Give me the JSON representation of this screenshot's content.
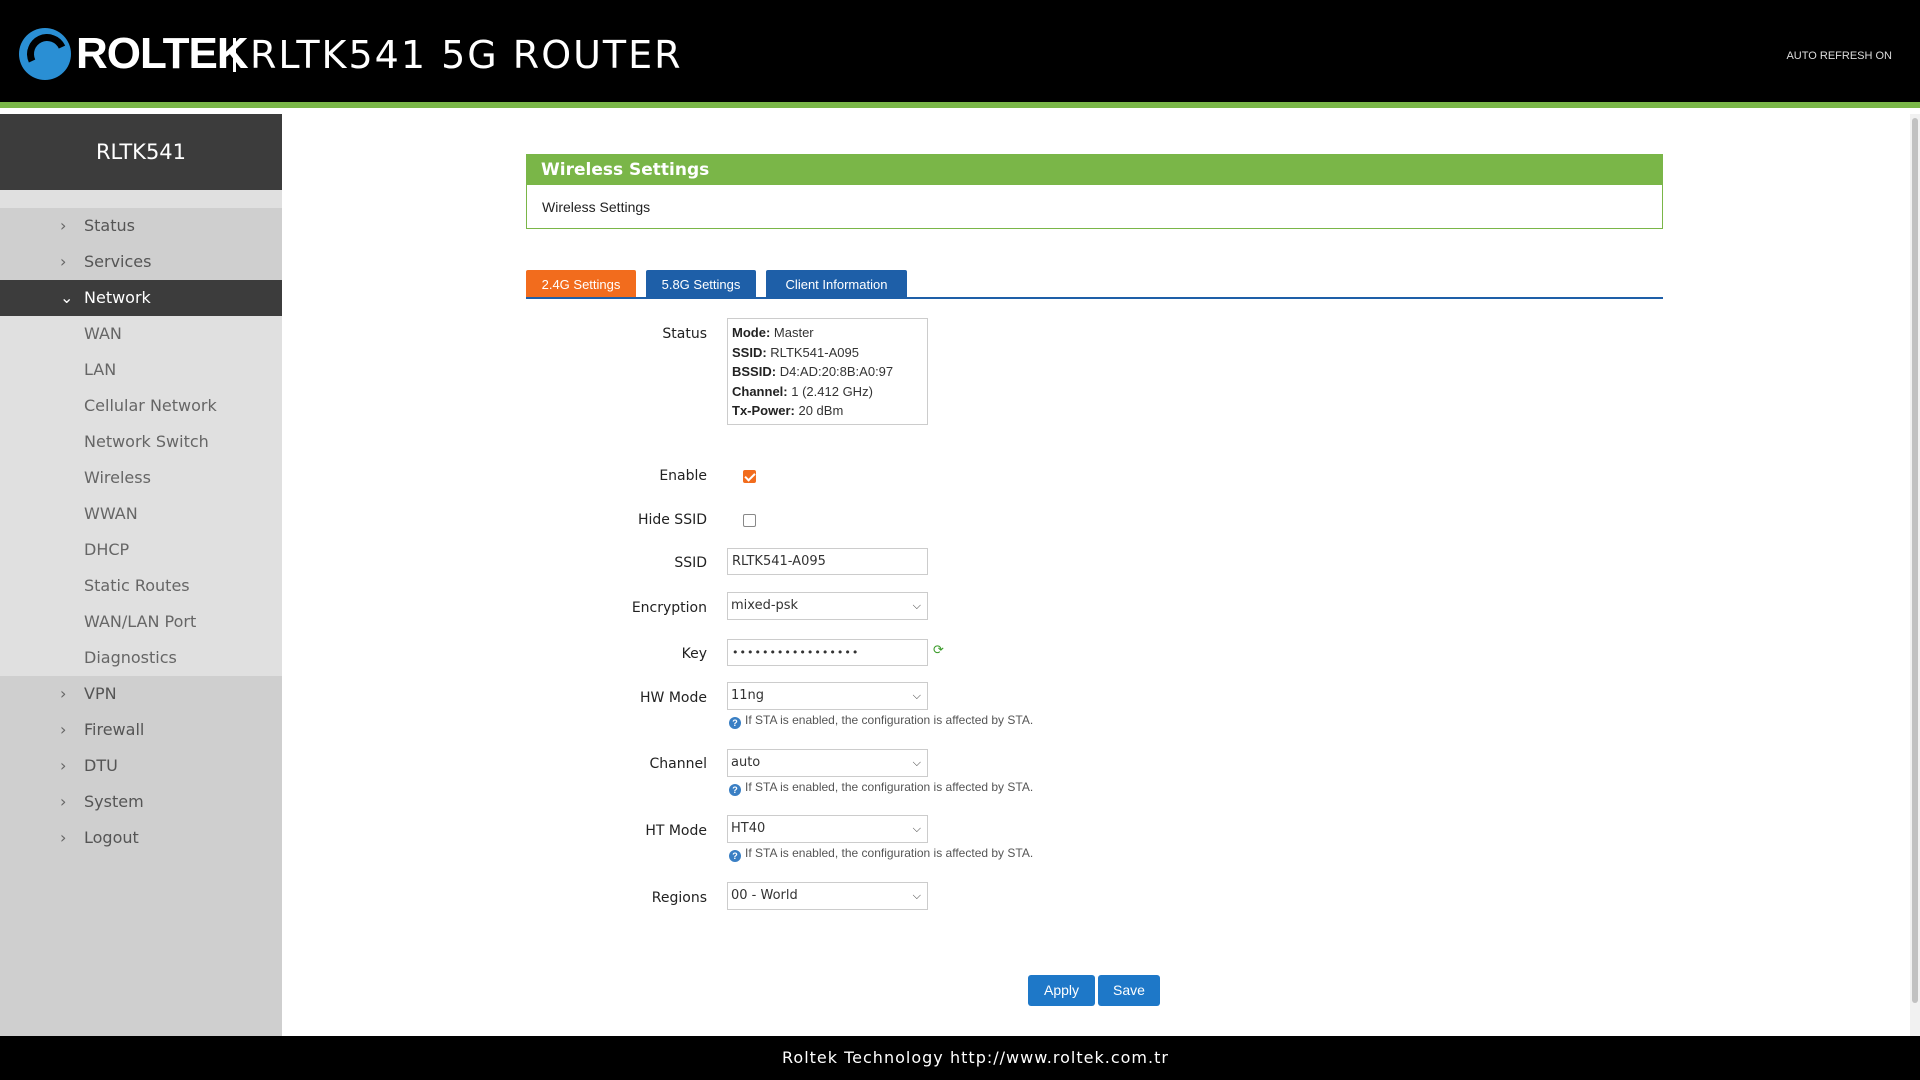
{
  "header": {
    "brand": "ROLTEK",
    "product": "RLTK541 5G ROUTER",
    "auto_refresh": "AUTO REFRESH ON"
  },
  "sidebar": {
    "title": "RLTK541",
    "items": [
      {
        "label": "Status"
      },
      {
        "label": "Services"
      },
      {
        "label": "Network"
      },
      {
        "label": "VPN"
      },
      {
        "label": "Firewall"
      },
      {
        "label": "DTU"
      },
      {
        "label": "System"
      },
      {
        "label": "Logout"
      }
    ],
    "network_sub": [
      {
        "label": "WAN"
      },
      {
        "label": "LAN"
      },
      {
        "label": "Cellular Network"
      },
      {
        "label": "Network Switch"
      },
      {
        "label": "Wireless"
      },
      {
        "label": "WWAN"
      },
      {
        "label": "DHCP"
      },
      {
        "label": "Static Routes"
      },
      {
        "label": "WAN/LAN Port"
      },
      {
        "label": "Diagnostics"
      }
    ]
  },
  "panel": {
    "title": "Wireless Settings",
    "body": "Wireless Settings"
  },
  "tabs": [
    {
      "label": "2.4G Settings"
    },
    {
      "label": "5.8G Settings"
    },
    {
      "label": "Client Information"
    }
  ],
  "form": {
    "status_label": "Status",
    "status": {
      "mode_key": "Mode:",
      "mode": "Master",
      "ssid_key": "SSID:",
      "ssid": "RLTK541-A095",
      "bssid_key": "BSSID:",
      "bssid": "D4:AD:20:8B:A0:97",
      "channel_key": "Channel:",
      "channel": "1 (2.412 GHz)",
      "txpower_key": "Tx-Power:",
      "txpower": "20 dBm"
    },
    "enable_label": "Enable",
    "enable_checked": true,
    "hide_ssid_label": "Hide SSID",
    "hide_ssid_checked": false,
    "ssid_label": "SSID",
    "ssid_value": "RLTK541-A095",
    "encryption_label": "Encryption",
    "encryption_value": "mixed-psk",
    "key_label": "Key",
    "key_value": "•••••••••••••••••",
    "hwmode_label": "HW Mode",
    "hwmode_value": "11ng",
    "channel_label": "Channel",
    "channel_value": "auto",
    "htmode_label": "HT Mode",
    "htmode_value": "HT40",
    "regions_label": "Regions",
    "regions_value": "00 - World",
    "hint": "If STA is enabled, the configuration is affected by STA."
  },
  "buttons": {
    "apply": "Apply",
    "save": "Save"
  },
  "footer": {
    "company": "Roltek Technology",
    "url": "http://www.roltek.com.tr"
  },
  "colors": {
    "accent_green": "#7ab648",
    "tab_active": "#f26c1d",
    "tab_blue": "#1e5fa8",
    "button_blue": "#1e78c8"
  }
}
